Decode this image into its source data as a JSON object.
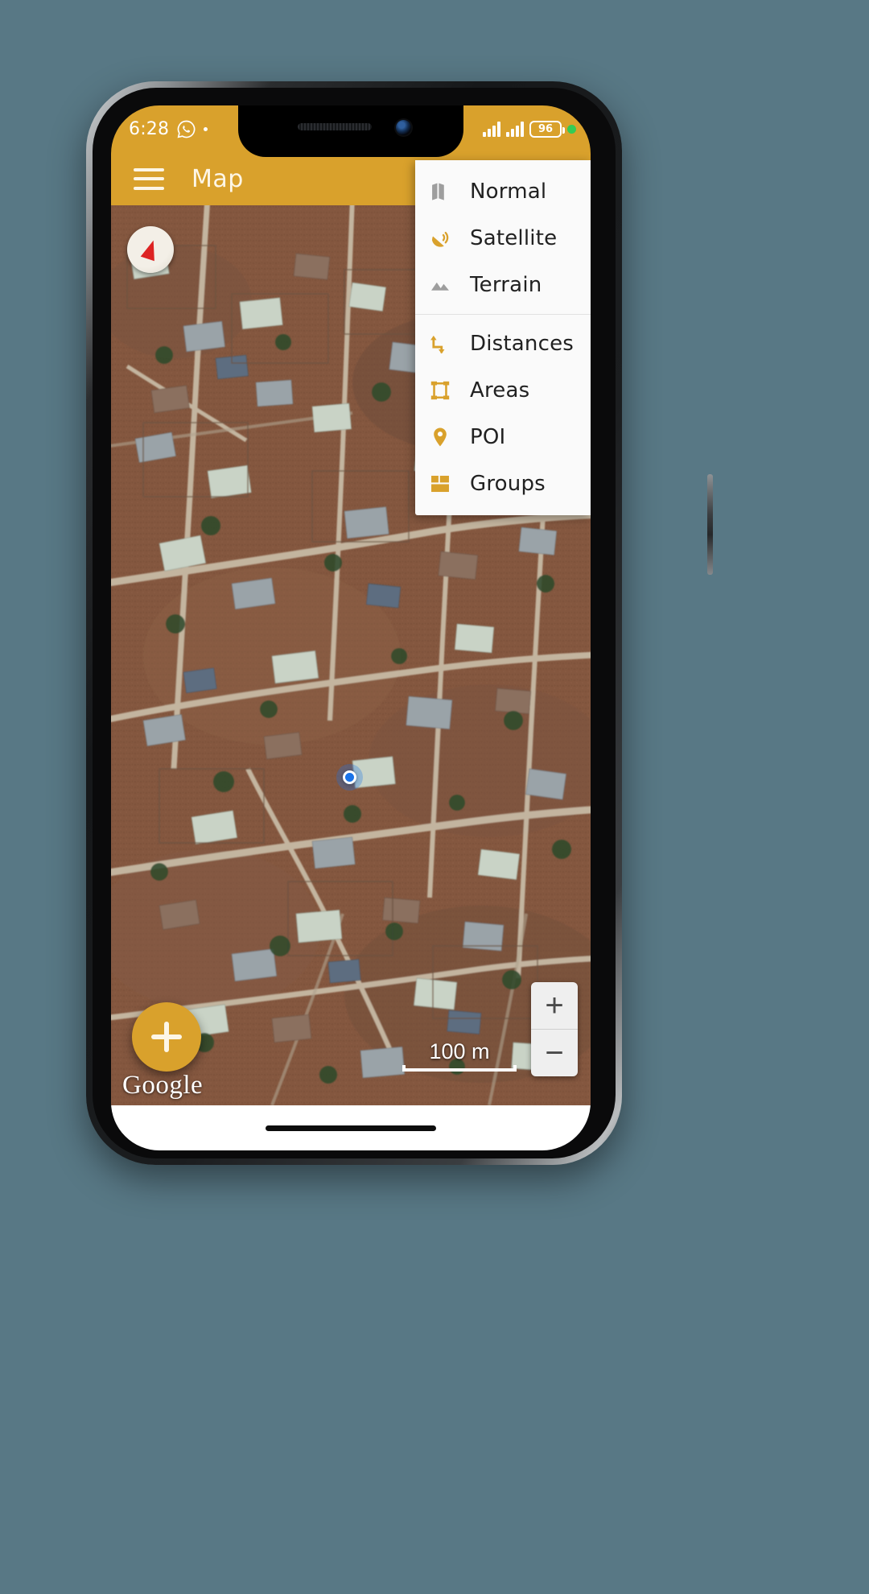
{
  "status_bar": {
    "time": "6:28",
    "whatsapp_icon": "whatsapp-icon",
    "notification_dot": "notification-dot",
    "signal_1_icon": "signal-bars-icon",
    "signal_2_icon": "signal-bars-icon",
    "battery_level": "96",
    "battery_icon": "battery-icon",
    "status_indicator": "green-status-dot"
  },
  "app_bar": {
    "menu_icon": "hamburger-menu-icon",
    "title": "Map"
  },
  "menu": {
    "sections": [
      {
        "items": [
          {
            "label": "Normal",
            "icon": "folded-map-icon",
            "color": "#9e9e9e"
          },
          {
            "label": "Satellite",
            "icon": "satellite-dish-icon",
            "color": "#d9a12c"
          },
          {
            "label": "Terrain",
            "icon": "mountains-icon",
            "color": "#9e9e9e"
          }
        ]
      },
      {
        "items": [
          {
            "label": "Distances",
            "icon": "zigzag-arrows-icon",
            "color": "#d9a12c"
          },
          {
            "label": "Areas",
            "icon": "area-frame-icon",
            "color": "#d9a12c"
          },
          {
            "label": "POI",
            "icon": "map-pin-icon",
            "color": "#d9a12c"
          },
          {
            "label": "Groups",
            "icon": "grid-blocks-icon",
            "color": "#d9a12c"
          }
        ]
      }
    ]
  },
  "map": {
    "type": "satellite-imagery",
    "compass_icon": "compass-needle-icon",
    "user_location_icon": "current-location-dot",
    "attribution": "Google",
    "scale_label": "100 m",
    "add_button_icon": "plus-icon",
    "zoom_in_label": "+",
    "zoom_out_label": "−"
  },
  "colors": {
    "accent": "#d9a12c",
    "app_bar_text": "#fdf6e6",
    "menu_bg": "#fafafa",
    "menu_text": "#212121",
    "icon_gray": "#9e9e9e",
    "page_bg": "#587885",
    "user_dot": "#1a73e8"
  }
}
